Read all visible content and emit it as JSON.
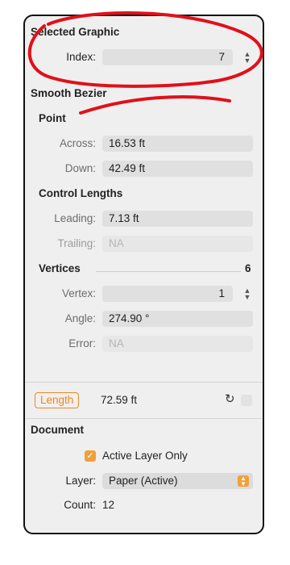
{
  "selected_graphic": {
    "title": "Selected Graphic",
    "index_label": "Index:",
    "index_value": "7"
  },
  "smooth_bezier": {
    "title": "Smooth Bezier",
    "point": {
      "title": "Point",
      "across_label": "Across:",
      "across_value": "16.53 ft",
      "down_label": "Down:",
      "down_value": "42.49 ft"
    },
    "control_lengths": {
      "title": "Control Lengths",
      "leading_label": "Leading:",
      "leading_value": "7.13 ft",
      "trailing_label": "Trailing:",
      "trailing_value": "NA"
    },
    "vertices": {
      "title": "Vertices",
      "count": "6",
      "vertex_label": "Vertex:",
      "vertex_value": "1",
      "angle_label": "Angle:",
      "angle_value": "274.90 °",
      "error_label": "Error:",
      "error_value": "NA"
    }
  },
  "length": {
    "button_label": "Length",
    "value": "72.59 ft"
  },
  "document": {
    "title": "Document",
    "active_layer_only_label": "Active Layer Only",
    "active_layer_only_checked": true,
    "layer_label": "Layer:",
    "layer_value": "Paper (Active)",
    "count_label": "Count:",
    "count_value": "12"
  },
  "annotation": {
    "color": "#e0101a"
  },
  "colors": {
    "accent": "#f0a03a"
  }
}
